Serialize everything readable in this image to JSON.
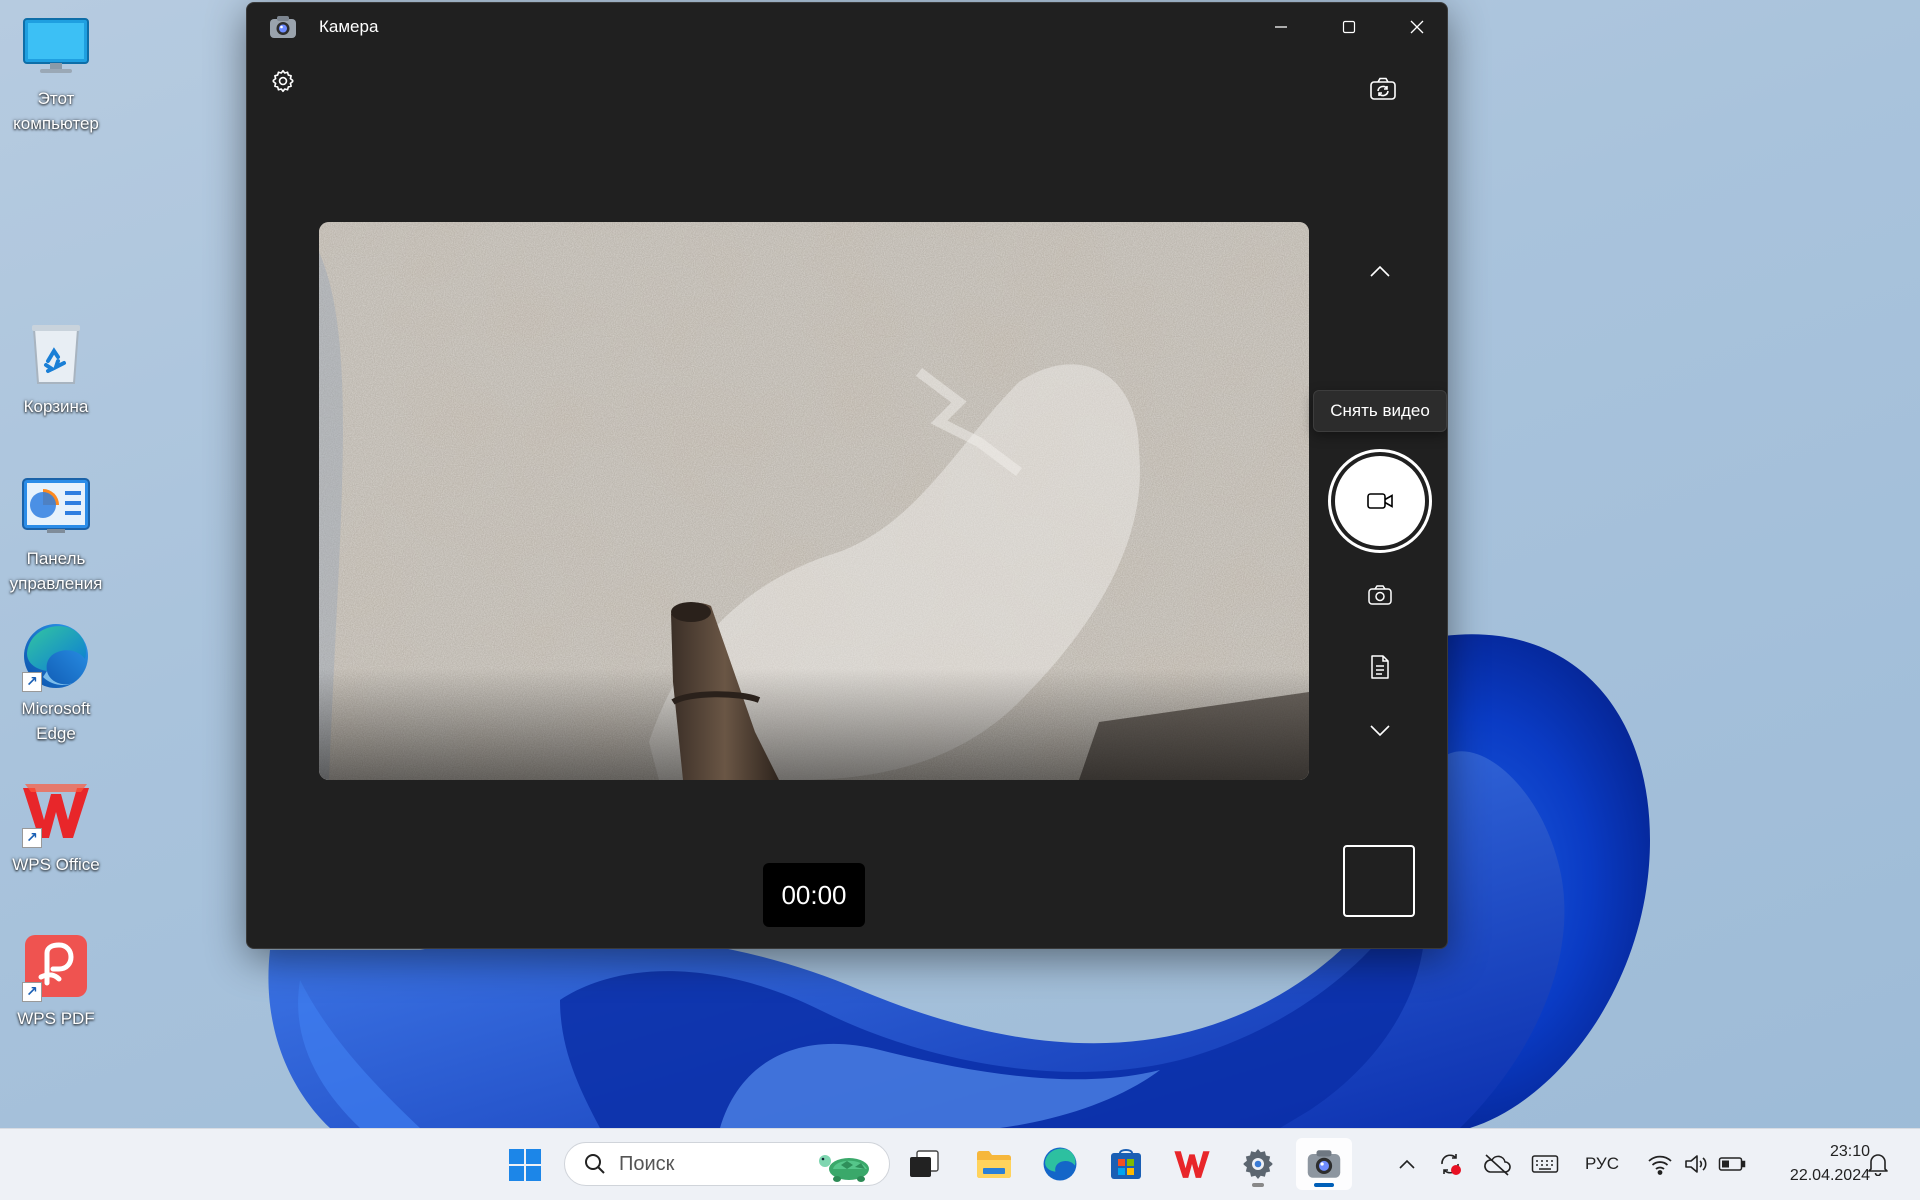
{
  "desktop": {
    "icons": [
      {
        "label": "Этот компьютер",
        "icon": "this-pc-icon"
      },
      {
        "label": "Корзина",
        "icon": "recycle-bin-icon"
      },
      {
        "label": "Панель управления",
        "icon": "control-panel-icon"
      },
      {
        "label": "Microsoft Edge",
        "icon": "edge-icon"
      },
      {
        "label": "WPS Office",
        "icon": "wps-office-icon"
      },
      {
        "label": "WPS PDF",
        "icon": "wps-pdf-icon"
      }
    ]
  },
  "camera_window": {
    "title": "Камера",
    "tooltip": "Снять видео",
    "timer": "00:00",
    "mode": "video"
  },
  "taskbar": {
    "search_placeholder": "Поиск",
    "apps": [
      "start",
      "search",
      "task-view",
      "file-explorer",
      "edge",
      "microsoft-store",
      "wps-office",
      "settings",
      "camera"
    ],
    "active_app": "camera",
    "tray": {
      "language": "РУС",
      "time": "23:10",
      "date": "22.04.2024"
    }
  },
  "colors": {
    "window_bg": "#202020",
    "accent": "#005fb8",
    "taskbar_bg": "#eef1f6"
  }
}
